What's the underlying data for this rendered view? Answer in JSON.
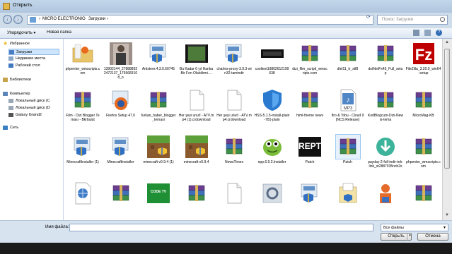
{
  "window": {
    "title": "Открыть"
  },
  "address": {
    "crumbs": [
      "MICRO ELECTRONIC",
      "Загрузки"
    ],
    "search_placeholder": "Поиск: Загрузки"
  },
  "toolbar": {
    "organize": "Упорядочить ▾",
    "new_folder": "Новая папка"
  },
  "nav": {
    "items": [
      {
        "label": "Избранное",
        "icon": "star-icon",
        "indent": 0,
        "selected": false
      },
      {
        "label": "Загрузки",
        "icon": "downloads-folder-icon",
        "indent": 1,
        "selected": true
      },
      {
        "label": "Недавние места",
        "icon": "recent-places-icon",
        "indent": 1,
        "selected": false
      },
      {
        "label": "Рабочий стол",
        "icon": "desktop-icon",
        "indent": 1,
        "selected": false
      },
      {
        "label": "Библиотеки",
        "icon": "libraries-icon",
        "indent": 0,
        "selected": false
      },
      {
        "label": "Компьютер",
        "icon": "computer-icon",
        "indent": 0,
        "selected": false
      },
      {
        "label": "Локальный диск (C",
        "icon": "drive-icon",
        "indent": 1,
        "selected": false
      },
      {
        "label": "Локальный диск (D",
        "icon": "drive-icon",
        "indent": 1,
        "selected": false
      },
      {
        "label": "Galaxy Grand2",
        "icon": "phone-icon",
        "indent": 1,
        "selected": false
      },
      {
        "label": "Сеть",
        "icon": "network-icon",
        "indent": 0,
        "selected": false
      }
    ]
  },
  "files": [
    {
      "label": "phpenter_wmscripts.com",
      "icon": "folder-icon"
    },
    {
      "label": "13902144_278888922472137_1755683108_o",
      "icon": "photo-icon"
    },
    {
      "label": "Artisteer.4.3.0.60745",
      "icon": "setup-icon"
    },
    {
      "label": "Bu Kadar 6 yıl Hanka Bir Fon Olabilirmi....",
      "icon": "video-icon"
    },
    {
      "label": "charles-proxy-3.9.3-win32-tamindir",
      "icon": "setup-icon"
    },
    {
      "label": "cooltext19802612199638",
      "icon": "image-dark-icon"
    },
    {
      "label": "dizi_film_scripti_wmscripts.com",
      "icon": "rar-icon"
    },
    {
      "label": "dlel11_tr_stf8",
      "icon": "rar-icon"
    },
    {
      "label": "dotNetFx45_Full_setup",
      "icon": "rar-icon"
    },
    {
      "label": "FileZilla_3.20.0_win64-setup",
      "icon": "filezilla-icon"
    },
    {
      "label": "Film - Dizi Blogger Teması - Bkrbulut",
      "icon": "rar-icon"
    },
    {
      "label": "Firefox Setup 47.0",
      "icon": "firefox-setup-icon"
    },
    {
      "label": "furkan_haber_blogger_temasi",
      "icon": "rar-icon"
    },
    {
      "label": "Her şeyi unut! - ATV.mp4 (1).crdownload",
      "icon": "blank-file-icon"
    },
    {
      "label": "Her şeyi unut! - ATV.mp4.crdownload",
      "icon": "blank-file-icon"
    },
    {
      "label": "HSS-5.1.5-install-plain-781-plain",
      "icon": "shield-installer-icon"
    },
    {
      "label": "html-theme news",
      "icon": "rar-icon"
    },
    {
      "label": "İtro & Tobu - Cloud 9 [NCS Release]",
      "icon": "mp3-icon"
    },
    {
      "label": "KodBlogcum-Dizi-Newis-tema",
      "icon": "rar-icon"
    },
    {
      "label": "MicroMag-KB",
      "icon": "rar-icon"
    },
    {
      "label": "MinecraftInstaller (1)",
      "icon": "setup-icon"
    },
    {
      "label": "MinecraftInstaller",
      "icon": "setup-icon"
    },
    {
      "label": "minecraft-v0.9.4 (1)",
      "icon": "minecraft-icon"
    },
    {
      "label": "minecraft-v0.9.4",
      "icon": "minecraft-icon"
    },
    {
      "label": "NewsTimes",
      "icon": "rar-icon"
    },
    {
      "label": "npp.6.9.2.Installer",
      "icon": "notepad-icon"
    },
    {
      "label": "Patch",
      "icon": "repatch-icon"
    },
    {
      "label": "Patch",
      "icon": "rar-icon"
    },
    {
      "label": "payday-2-full-indir-tek-link_st2887035ncb2s",
      "icon": "download-icon"
    },
    {
      "label": "phpenter_wmscripts.com",
      "icon": "rar-icon"
    },
    {
      "label": "",
      "icon": "html-doc-icon"
    },
    {
      "label": "",
      "icon": "rar-icon"
    },
    {
      "label": "",
      "icon": "green-image-icon"
    },
    {
      "label": "",
      "icon": "rar-icon"
    },
    {
      "label": "",
      "icon": "blank-file-icon"
    },
    {
      "label": "",
      "icon": "settings-setup-icon"
    },
    {
      "label": "",
      "icon": "setup-icon"
    },
    {
      "label": "",
      "icon": "installer-box-icon"
    },
    {
      "label": "",
      "icon": "person-setup-icon"
    },
    {
      "label": "",
      "icon": "rar-icon"
    }
  ],
  "green_image_text": "CODE TV",
  "bottom": {
    "filename_label": "Имя файла:",
    "filename_value": "",
    "filetype": "Все файлы",
    "open": "Открыть",
    "cancel": "Отмена"
  },
  "colors": {
    "rar_purple": "#6b3d8f",
    "rar_blue": "#3f6fb8",
    "rar_green": "#3d8f4a",
    "selection": "#cde4fb"
  }
}
